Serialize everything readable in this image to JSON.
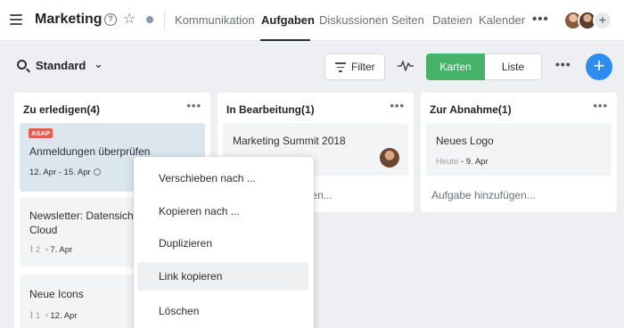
{
  "header": {
    "title": "Marketing",
    "nav": [
      {
        "label": "Kommunikation",
        "active": false
      },
      {
        "label": "Aufgaben",
        "active": true
      },
      {
        "label": "Diskussionen",
        "active": false
      },
      {
        "label": "Seiten",
        "active": false
      },
      {
        "label": "Dateien",
        "active": false
      },
      {
        "label": "Kalender",
        "active": false
      }
    ],
    "more": "•••",
    "add_member": "+"
  },
  "toolbar": {
    "view": "Standard",
    "filter": "Filter",
    "karten": "Karten",
    "liste": "Liste",
    "more": "•••",
    "add": "+"
  },
  "columns": [
    {
      "title": "Zu erledigen(4)",
      "cards": [
        {
          "badge": "ASAP",
          "title": "Anmeldungen überprüfen",
          "meta": "12. Apr - 15. Apr"
        },
        {
          "title_line1": "Newsletter: Datensich",
          "title_line2": "Cloud",
          "attachments": "2",
          "date": "7. Apr"
        },
        {
          "title": "Neue Icons",
          "attachments": "1",
          "date": "12. Apr"
        }
      ]
    },
    {
      "title": "In Bearbeitung(1)",
      "cards": [
        {
          "title": "Marketing Summit 2018"
        }
      ],
      "add_task": "Aufgabe hinzufügen..."
    },
    {
      "title": "Zur Abnahme(1)",
      "cards": [
        {
          "title": "Neues Logo",
          "start": "Heute",
          "end": "- 9. Apr"
        }
      ],
      "add_task": "Aufgabe hinzufügen..."
    }
  ],
  "context_menu": {
    "items": [
      "Verschieben nach ...",
      "Kopieren nach ...",
      "Duplizieren",
      "Link kopieren",
      "Löschen"
    ],
    "highlighted": "Link kopieren"
  },
  "colors": {
    "accent_green": "#47b36a",
    "fab_blue": "#2d8cf0",
    "badge_red": "#e35d4f",
    "selected_card": "#dbe6ef"
  }
}
